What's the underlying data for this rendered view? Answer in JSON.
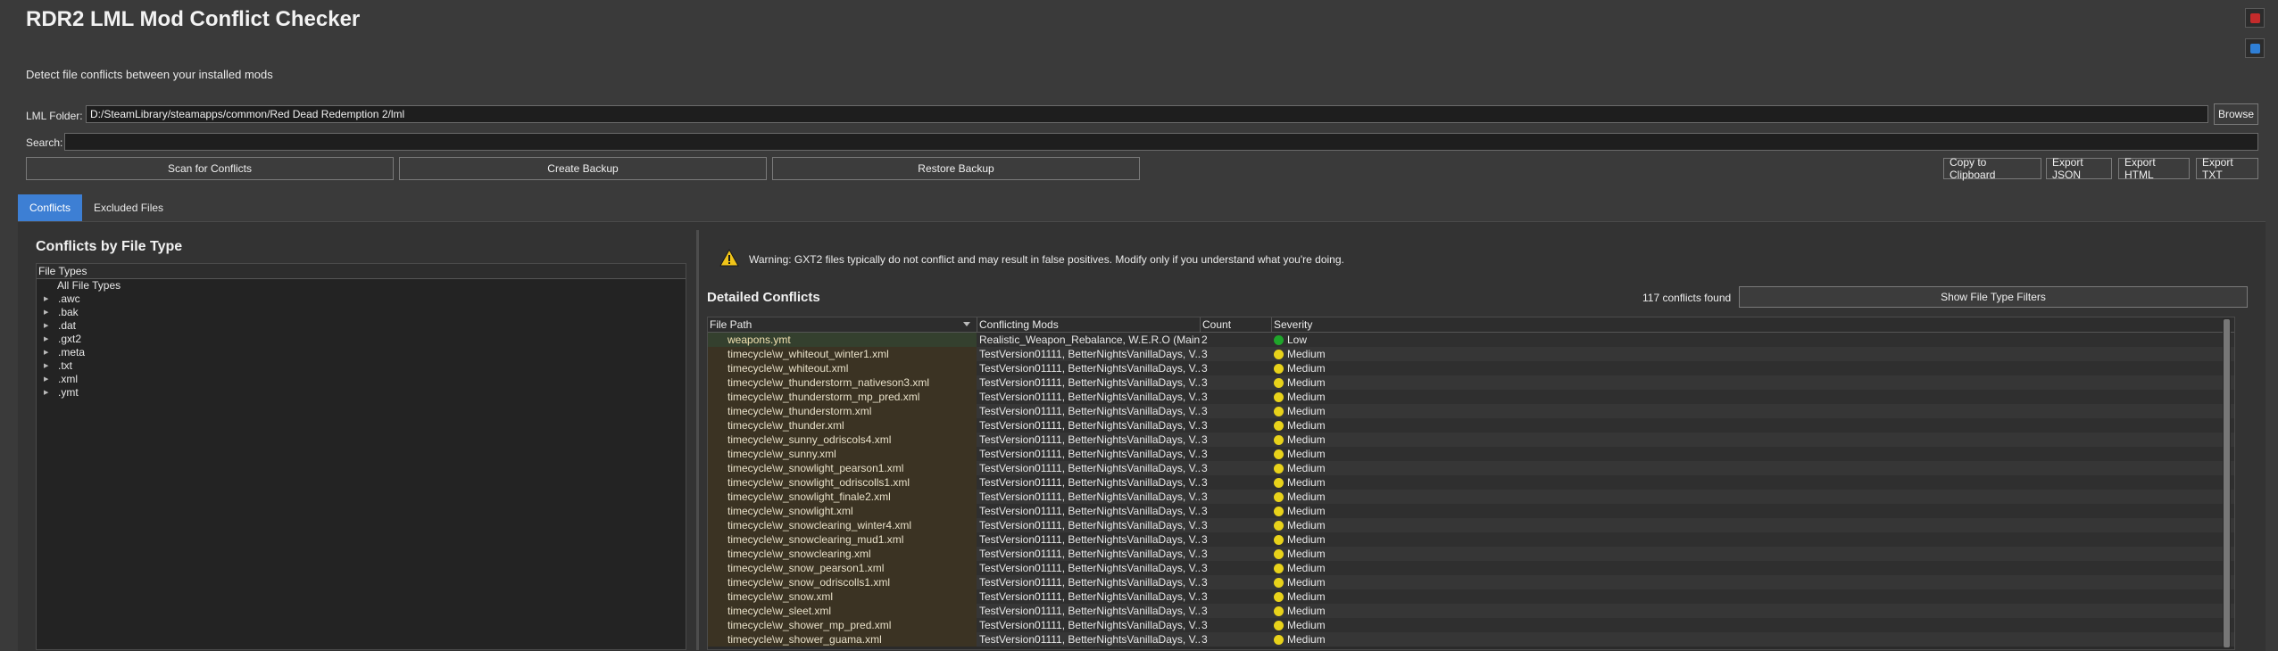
{
  "app": {
    "title": "RDR2 LML Mod Conflict Checker",
    "subtitle": "Detect file conflicts between your installed mods"
  },
  "corner_buttons": [
    {
      "icon": "help-icon",
      "color": "#c42b2b"
    },
    {
      "icon": "checkbox-icon",
      "color": "#2f7fd6"
    }
  ],
  "folder": {
    "label": "LML Folder:",
    "value": "D:/SteamLibrary/steamapps/common/Red Dead Redemption 2/lml",
    "browse_label": "Browse"
  },
  "search": {
    "label": "Search:",
    "value": ""
  },
  "actions": {
    "scan": "Scan for Conflicts",
    "create_backup": "Create Backup",
    "restore_backup": "Restore Backup",
    "copy_clipboard": "Copy to Clipboard",
    "export_json": "Export JSON",
    "export_html": "Export HTML",
    "export_txt": "Export TXT"
  },
  "tabs": [
    {
      "label": "Conflicts",
      "active": true
    },
    {
      "label": "Excluded Files",
      "active": false
    }
  ],
  "left_panel": {
    "title": "Conflicts by File Type",
    "tree_header": "File Types",
    "root": "All File Types",
    "items": [
      ".awc",
      ".bak",
      ".dat",
      ".gxt2",
      ".meta",
      ".txt",
      ".xml",
      ".ymt"
    ]
  },
  "warning": {
    "icon": "warning-icon",
    "text": "Warning: GXT2 files typically do not conflict and may result in false positives. Modify only if you understand what you're doing."
  },
  "details": {
    "title": "Detailed Conflicts",
    "count_text": "117 conflicts found",
    "filter_button": "Show File Type Filters",
    "columns": [
      "File Path",
      "Conflicting Mods",
      "Count",
      "Severity"
    ],
    "rows": [
      {
        "path": "weapons.ymt",
        "mods": "Realistic_Weapon_Rebalance, W.E.R.O (Main...",
        "count": "2",
        "severity": "Low",
        "color": "#1fa52a"
      },
      {
        "path": "timecycle\\w_whiteout_winter1.xml",
        "mods": "TestVersion01111, BetterNightsVanillaDays, V...",
        "count": "3",
        "severity": "Medium",
        "color": "#e8d21a"
      },
      {
        "path": "timecycle\\w_whiteout.xml",
        "mods": "TestVersion01111, BetterNightsVanillaDays, V...",
        "count": "3",
        "severity": "Medium",
        "color": "#e8d21a"
      },
      {
        "path": "timecycle\\w_thunderstorm_nativeson3.xml",
        "mods": "TestVersion01111, BetterNightsVanillaDays, V...",
        "count": "3",
        "severity": "Medium",
        "color": "#e8d21a"
      },
      {
        "path": "timecycle\\w_thunderstorm_mp_pred.xml",
        "mods": "TestVersion01111, BetterNightsVanillaDays, V...",
        "count": "3",
        "severity": "Medium",
        "color": "#e8d21a"
      },
      {
        "path": "timecycle\\w_thunderstorm.xml",
        "mods": "TestVersion01111, BetterNightsVanillaDays, V...",
        "count": "3",
        "severity": "Medium",
        "color": "#e8d21a"
      },
      {
        "path": "timecycle\\w_thunder.xml",
        "mods": "TestVersion01111, BetterNightsVanillaDays, V...",
        "count": "3",
        "severity": "Medium",
        "color": "#e8d21a"
      },
      {
        "path": "timecycle\\w_sunny_odriscols4.xml",
        "mods": "TestVersion01111, BetterNightsVanillaDays, V...",
        "count": "3",
        "severity": "Medium",
        "color": "#e8d21a"
      },
      {
        "path": "timecycle\\w_sunny.xml",
        "mods": "TestVersion01111, BetterNightsVanillaDays, V...",
        "count": "3",
        "severity": "Medium",
        "color": "#e8d21a"
      },
      {
        "path": "timecycle\\w_snowlight_pearson1.xml",
        "mods": "TestVersion01111, BetterNightsVanillaDays, V...",
        "count": "3",
        "severity": "Medium",
        "color": "#e8d21a"
      },
      {
        "path": "timecycle\\w_snowlight_odriscolls1.xml",
        "mods": "TestVersion01111, BetterNightsVanillaDays, V...",
        "count": "3",
        "severity": "Medium",
        "color": "#e8d21a"
      },
      {
        "path": "timecycle\\w_snowlight_finale2.xml",
        "mods": "TestVersion01111, BetterNightsVanillaDays, V...",
        "count": "3",
        "severity": "Medium",
        "color": "#e8d21a"
      },
      {
        "path": "timecycle\\w_snowlight.xml",
        "mods": "TestVersion01111, BetterNightsVanillaDays, V...",
        "count": "3",
        "severity": "Medium",
        "color": "#e8d21a"
      },
      {
        "path": "timecycle\\w_snowclearing_winter4.xml",
        "mods": "TestVersion01111, BetterNightsVanillaDays, V...",
        "count": "3",
        "severity": "Medium",
        "color": "#e8d21a"
      },
      {
        "path": "timecycle\\w_snowclearing_mud1.xml",
        "mods": "TestVersion01111, BetterNightsVanillaDays, V...",
        "count": "3",
        "severity": "Medium",
        "color": "#e8d21a"
      },
      {
        "path": "timecycle\\w_snowclearing.xml",
        "mods": "TestVersion01111, BetterNightsVanillaDays, V...",
        "count": "3",
        "severity": "Medium",
        "color": "#e8d21a"
      },
      {
        "path": "timecycle\\w_snow_pearson1.xml",
        "mods": "TestVersion01111, BetterNightsVanillaDays, V...",
        "count": "3",
        "severity": "Medium",
        "color": "#e8d21a"
      },
      {
        "path": "timecycle\\w_snow_odriscolls1.xml",
        "mods": "TestVersion01111, BetterNightsVanillaDays, V...",
        "count": "3",
        "severity": "Medium",
        "color": "#e8d21a"
      },
      {
        "path": "timecycle\\w_snow.xml",
        "mods": "TestVersion01111, BetterNightsVanillaDays, V...",
        "count": "3",
        "severity": "Medium",
        "color": "#e8d21a"
      },
      {
        "path": "timecycle\\w_sleet.xml",
        "mods": "TestVersion01111, BetterNightsVanillaDays, V...",
        "count": "3",
        "severity": "Medium",
        "color": "#e8d21a"
      },
      {
        "path": "timecycle\\w_shower_mp_pred.xml",
        "mods": "TestVersion01111, BetterNightsVanillaDays, V...",
        "count": "3",
        "severity": "Medium",
        "color": "#e8d21a"
      },
      {
        "path": "timecycle\\w_shower_guama.xml",
        "mods": "TestVersion01111, BetterNightsVanillaDays, V...",
        "count": "3",
        "severity": "Medium",
        "color": "#e8d21a"
      }
    ]
  }
}
